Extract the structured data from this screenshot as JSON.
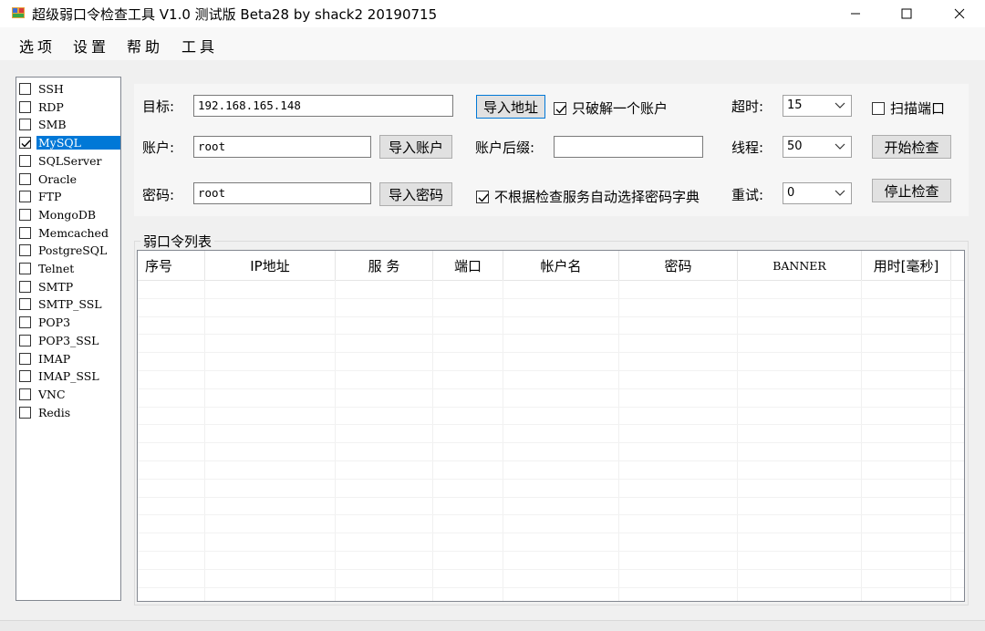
{
  "window": {
    "title": "超级弱口令检查工具 V1.0 测试版 Beta28 by shack2 20190715"
  },
  "menu": {
    "items": [
      {
        "label": "选项"
      },
      {
        "label": "设置"
      },
      {
        "label": "帮助"
      },
      {
        "label": "工具"
      }
    ]
  },
  "services": [
    {
      "label": "SSH",
      "checked": false
    },
    {
      "label": "RDP",
      "checked": false
    },
    {
      "label": "SMB",
      "checked": false
    },
    {
      "label": "MySQL",
      "checked": true,
      "selected": true
    },
    {
      "label": "SQLServer",
      "checked": false
    },
    {
      "label": "Oracle",
      "checked": false
    },
    {
      "label": "FTP",
      "checked": false
    },
    {
      "label": "MongoDB",
      "checked": false
    },
    {
      "label": "Memcached",
      "checked": false
    },
    {
      "label": "PostgreSQL",
      "checked": false
    },
    {
      "label": "Telnet",
      "checked": false
    },
    {
      "label": "SMTP",
      "checked": false
    },
    {
      "label": "SMTP_SSL",
      "checked": false
    },
    {
      "label": "POP3",
      "checked": false
    },
    {
      "label": "POP3_SSL",
      "checked": false
    },
    {
      "label": "IMAP",
      "checked": false
    },
    {
      "label": "IMAP_SSL",
      "checked": false
    },
    {
      "label": "VNC",
      "checked": false
    },
    {
      "label": "Redis",
      "checked": false
    }
  ],
  "config": {
    "target_label": "目标:",
    "target_value": "192.168.165.148",
    "import_address_button": "导入地址",
    "only_one_account_label": "只破解一个账户",
    "only_one_account_checked": true,
    "timeout_label": "超时:",
    "timeout_value": "15",
    "scan_ports_label": "扫描端口",
    "scan_ports_checked": false,
    "account_label": "账户:",
    "account_value": "root",
    "import_account_button": "导入账户",
    "account_suffix_label": "账户后缀:",
    "account_suffix_value": "",
    "threads_label": "线程:",
    "threads_value": "50",
    "start_button": "开始检查",
    "password_label": "密码:",
    "password_value": "root",
    "import_password_button": "导入密码",
    "auto_dict_label": "不根据检查服务自动选择密码字典",
    "auto_dict_checked": true,
    "retry_label": "重试:",
    "retry_value": "0",
    "stop_button": "停止检查"
  },
  "results": {
    "group_title": "弱口令列表",
    "columns": [
      "序号",
      "IP地址",
      "服 务",
      "端口",
      "帐户名",
      "密码",
      "BANNER",
      "用时[毫秒]"
    ]
  }
}
